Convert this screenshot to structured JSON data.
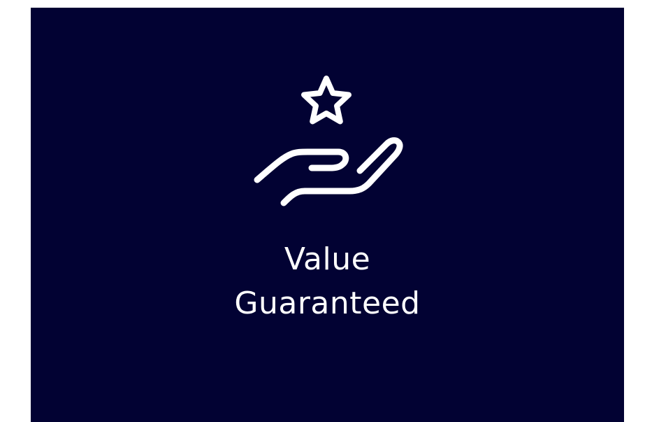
{
  "card": {
    "background_color": "#020233",
    "title_line1": "Value",
    "title_line2": "Guaranteed",
    "icon": "hand-holding-star-icon"
  }
}
